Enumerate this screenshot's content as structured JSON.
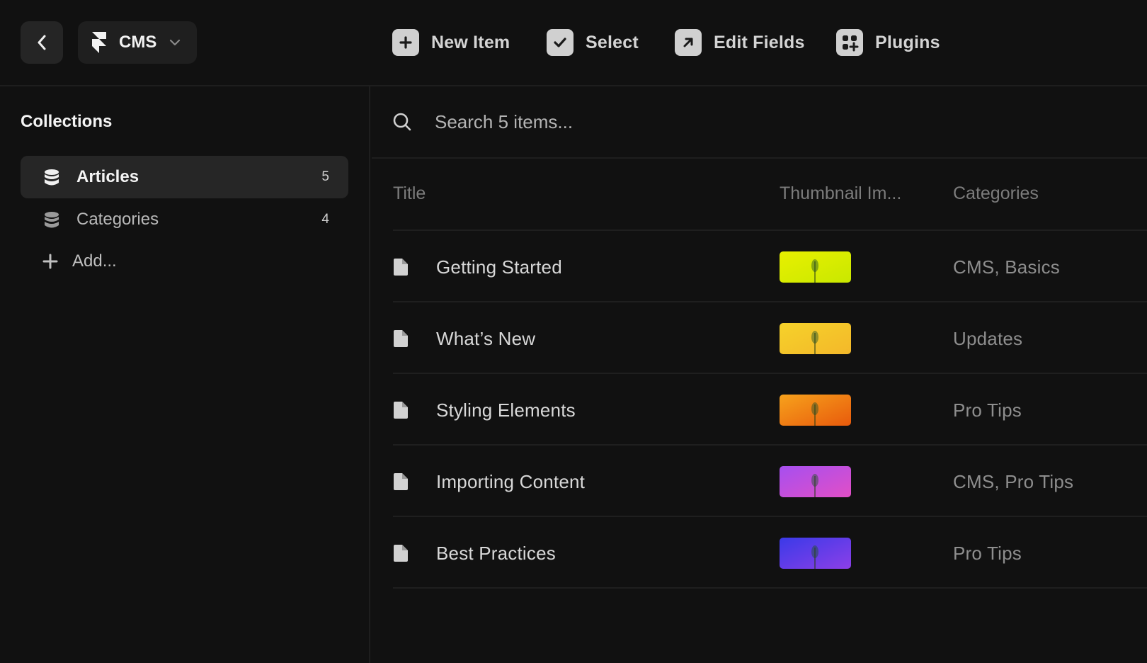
{
  "toolbar": {
    "cms_label": "CMS",
    "new_item": "New Item",
    "select": "Select",
    "edit_fields": "Edit Fields",
    "plugins": "Plugins"
  },
  "sidebar": {
    "title": "Collections",
    "collections": [
      {
        "name": "Articles",
        "count": "5"
      },
      {
        "name": "Categories",
        "count": "4"
      }
    ],
    "add_label": "Add..."
  },
  "search": {
    "placeholder": "Search 5 items..."
  },
  "table": {
    "columns": [
      "Title",
      "Thumbnail Im...",
      "Categories"
    ],
    "rows": [
      {
        "title": "Getting Started",
        "categories": "CMS, Basics",
        "thumb_colors": [
          "#e8f000",
          "#c9e800"
        ]
      },
      {
        "title": "What’s New",
        "categories": "Updates",
        "thumb_colors": [
          "#f6d22a",
          "#f3b82a"
        ]
      },
      {
        "title": "Styling Elements",
        "categories": "Pro Tips",
        "thumb_colors": [
          "#f7a21c",
          "#e85a0c"
        ]
      },
      {
        "title": "Importing Content",
        "categories": "CMS, Pro Tips",
        "thumb_colors": [
          "#a64ff0",
          "#e24fc6"
        ]
      },
      {
        "title": "Best Practices",
        "categories": "Pro Tips",
        "thumb_colors": [
          "#3a3ae8",
          "#8c3fe8"
        ]
      }
    ]
  },
  "colors": {
    "background": "#111111",
    "active_item": "#262626",
    "divider": "#1f1f1f"
  }
}
